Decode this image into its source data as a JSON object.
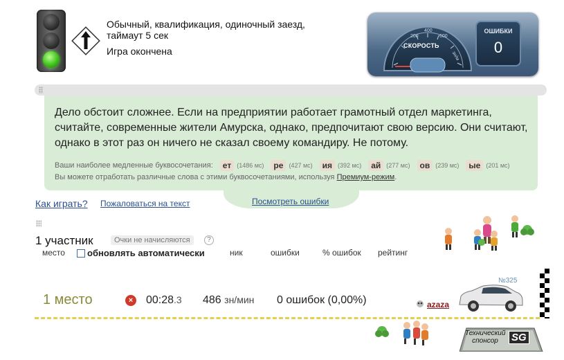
{
  "race_info": {
    "mode": "Обычный, квалификация, одиночный заезд,",
    "timeout": "таймаут 5 сек",
    "status": "Игра окончена"
  },
  "dashboard": {
    "speed_label": "СКОРОСТЬ",
    "gauge_ticks": [
      "200",
      "400",
      "600"
    ],
    "gauge_unit": "зн/м",
    "errors_label": "ОШИБКИ",
    "errors_value": "0"
  },
  "text_panel": {
    "main_text": "Дело обстоит сложнее. Если на предприятии работает грамотный отдел маркетинга, считайте, современные жители Амурска, однако, предпочитают свою версию. Они считают, однако в этот раз он ничего не сказал своему командиру. Не потому.",
    "slow_label": "Ваши наиболее медленные буквосочетания:",
    "slow_combos": [
      {
        "combo": "ет",
        "ms": "(1486 мс)"
      },
      {
        "combo": "ре",
        "ms": "(427 мс)"
      },
      {
        "combo": "ия",
        "ms": "(392 мс)"
      },
      {
        "combo": "ай",
        "ms": "(277 мс)"
      },
      {
        "combo": "ов",
        "ms": "(239 мс)"
      },
      {
        "combo": "ые",
        "ms": "(201 мс)"
      }
    ],
    "tip_prefix": "Вы можете отработать различные слова с этими буквосочетаниями, используя",
    "premium_link": "Премиум-режим",
    "tip_suffix": "."
  },
  "links": {
    "how_to_play": "Как играть?",
    "complain": "Пожаловаться на текст",
    "view_errors": "Посмотреть ошибки"
  },
  "participants": {
    "count_label": "1 участник",
    "no_points": "Очки не начисляются",
    "help": "?",
    "columns": {
      "place": "место",
      "auto_update": "обновлять автоматически",
      "nick": "ник",
      "errors": "ошибки",
      "percent_errors": "% ошибок",
      "rating": "рейтинг"
    }
  },
  "result": {
    "place": "1 место",
    "fail_icon": "x-icon",
    "time_main": "00:28",
    "time_frac": ".3",
    "speed_value": "486",
    "speed_unit": "зн/мин",
    "errors_text": "0 ошибок (0,00%)",
    "car_number": "№325",
    "username": "azaza"
  },
  "sponsor": {
    "label": "Технический спонсор",
    "logo": "SG"
  },
  "colors": {
    "panel_green": "#d8ecd6",
    "link_blue": "#2a4f8f",
    "road_yellow": "#e3cf52",
    "username_red": "#8b1a1a"
  }
}
